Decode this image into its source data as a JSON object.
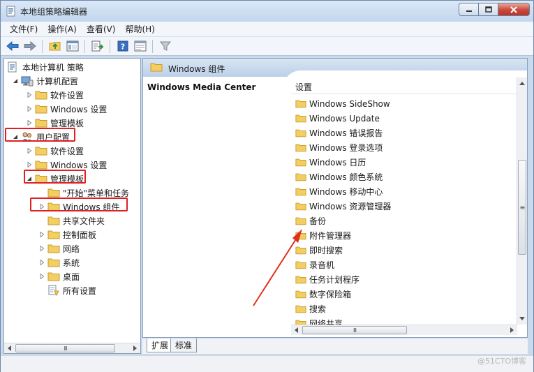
{
  "window": {
    "title": "本地组策略编辑器",
    "controls": {
      "minimize_icon": "minimize-icon",
      "maximize_icon": "maximize-icon",
      "close_icon": "close-icon"
    }
  },
  "menubar": {
    "items": [
      {
        "label": "文件(F)"
      },
      {
        "label": "操作(A)"
      },
      {
        "label": "查看(V)"
      },
      {
        "label": "帮助(H)"
      }
    ]
  },
  "toolbar": {
    "buttons": [
      "back-arrow-icon",
      "forward-arrow-icon",
      "up-folder-icon",
      "show-hide-tree-icon",
      "export-list-icon",
      "help-icon",
      "properties-icon",
      "filter-icon"
    ]
  },
  "tree": {
    "root": "本地计算机 策略",
    "computer_config": "计算机配置",
    "cc_software": "软件设置",
    "cc_windows": "Windows 设置",
    "cc_admin": "管理模板",
    "user_config": "用户配置",
    "uc_software": "软件设置",
    "uc_windows": "Windows 设置",
    "uc_admin": "管理模板",
    "uc_start_menu": "\"开始\"菜单和任务",
    "uc_win_components": "Windows 组件",
    "uc_shared_folders": "共享文件夹",
    "uc_control_panel": "控制面板",
    "uc_network": "网络",
    "uc_system": "系统",
    "uc_desktop": "桌面",
    "uc_all_settings": "所有设置"
  },
  "right_pane": {
    "header_title": "Windows 组件",
    "selected_title": "Windows Media Center",
    "column_header": "设置",
    "settings": [
      "Windows SideShow",
      "Windows Update",
      "Windows 错误报告",
      "Windows 登录选项",
      "Windows 日历",
      "Windows 颜色系统",
      "Windows 移动中心",
      "Windows 资源管理器",
      "备份",
      "附件管理器",
      "即时搜索",
      "录音机",
      "任务计划程序",
      "数字保险箱",
      "搜索",
      "网络共享"
    ]
  },
  "tabs": [
    {
      "label": "扩展"
    },
    {
      "label": "标准"
    }
  ],
  "scrollbar_grip": "III",
  "watermark": "@51CTO博客",
  "colors": {
    "highlight_box": "#e02020",
    "arrow": "#e0301e",
    "folder": "#f3cf63",
    "header_blue": "#bcd0e8"
  }
}
